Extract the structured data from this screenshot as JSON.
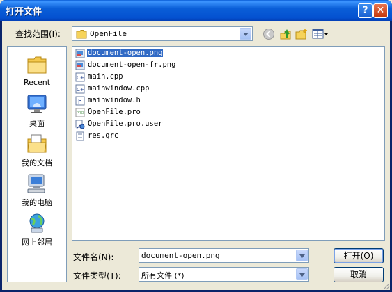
{
  "window": {
    "title": "打开文件",
    "help_glyph": "?",
    "close_glyph": "✕"
  },
  "lookin": {
    "label": "查找范围(I):",
    "value": "OpenFile"
  },
  "toolbar": {
    "icons": [
      "back-icon",
      "up-folder-icon",
      "new-folder-icon",
      "views-menu-icon"
    ]
  },
  "places": [
    {
      "label": "Recent",
      "icon": "recent-folder-icon"
    },
    {
      "label": "桌面",
      "icon": "desktop-icon"
    },
    {
      "label": "我的文档",
      "icon": "my-documents-icon"
    },
    {
      "label": "我的电脑",
      "icon": "my-computer-icon"
    },
    {
      "label": "网上邻居",
      "icon": "network-places-icon"
    }
  ],
  "files": [
    {
      "name": "document-open.png",
      "icon": "png-file-icon",
      "selected": true
    },
    {
      "name": "document-open-fr.png",
      "icon": "png-file-icon"
    },
    {
      "name": "main.cpp",
      "icon": "cpp-file-icon"
    },
    {
      "name": "mainwindow.cpp",
      "icon": "cpp-file-icon"
    },
    {
      "name": "mainwindow.h",
      "icon": "h-file-icon"
    },
    {
      "name": "OpenFile.pro",
      "icon": "pro-file-icon"
    },
    {
      "name": "OpenFile.pro.user",
      "icon": "user-file-icon"
    },
    {
      "name": "res.qrc",
      "icon": "qrc-file-icon"
    }
  ],
  "filename": {
    "label": "文件名(N):",
    "value": "document-open.png"
  },
  "filetype": {
    "label": "文件类型(T):",
    "value": "所有文件 (*)"
  },
  "buttons": {
    "open": "打开(O)",
    "cancel": "取消"
  },
  "colors": {
    "titlebar": "#0a5fd8",
    "face": "#ece9d8",
    "selection": "#316ac5",
    "border": "#7f9db9"
  }
}
